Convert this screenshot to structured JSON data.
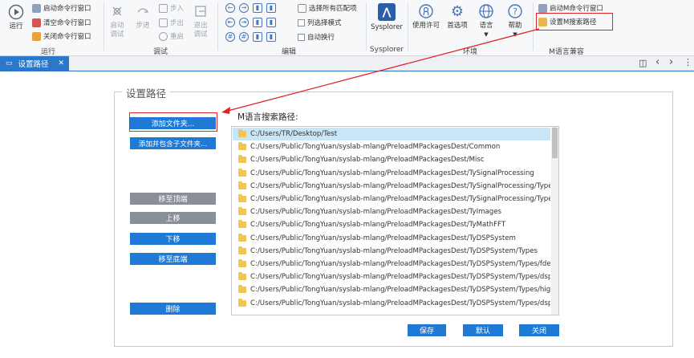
{
  "ribbon": {
    "run_group": {
      "run_label": "运行",
      "cmd_start": "启动命令行窗口",
      "cmd_clear": "清空命令行窗口",
      "cmd_close": "关闭命令行窗口",
      "group_label": "运行"
    },
    "debug_group": {
      "start_debug": "启动\n调试",
      "step_over": "步进",
      "step_in": "步入",
      "step_out": "步出",
      "restart": "重启",
      "exit_debug": "退出\n调试",
      "group_label": "调试"
    },
    "edit_group": {
      "select_all_matches": "选择所有匹配项",
      "column_select": "列选择模式",
      "auto_wrap": "自动换行",
      "group_label": "编辑"
    },
    "sysplorer_group": {
      "label": "Sysplorer",
      "group_label": "Sysplorer"
    },
    "env_group": {
      "license": "使用许可",
      "preferences": "首选项",
      "language": "语言",
      "help": "帮助",
      "group_label": "环境"
    },
    "mcompat_group": {
      "start_m_cmd": "启动M命令行窗口",
      "set_m_path": "设置M搜索路径",
      "group_label": "M语言兼容"
    }
  },
  "tabbar": {
    "tab_label": "设置路径",
    "close_glyph": "✕",
    "layout_glyph": "◫",
    "prev_glyph": "‹",
    "next_glyph": "›",
    "more_glyph": "⋮"
  },
  "dialog": {
    "legend": "设置路径",
    "path_list_label": "M语言搜索路径:",
    "buttons": {
      "add_folder": "添加文件夹...",
      "add_with_subfolders": "添加并包含子文件夹...",
      "move_top": "移至顶端",
      "move_up": "上移",
      "move_down": "下移",
      "move_bottom": "移至底端",
      "delete": "删除",
      "save": "保存",
      "default": "默认",
      "close": "关闭"
    },
    "paths": [
      "C:/Users/TR/Desktop/Test",
      "C:/Users/Public/TongYuan/syslab-mlang/PreloadMPackagesDest/Common",
      "C:/Users/Public/TongYuan/syslab-mlang/PreloadMPackagesDest/Misc",
      "C:/Users/Public/TongYuan/syslab-mlang/PreloadMPackagesDest/TySignalProcessing",
      "C:/Users/Public/TongYuan/syslab-mlang/PreloadMPackagesDest/TySignalProcessing/Types",
      "C:/Users/Public/TongYuan/syslab-mlang/PreloadMPackagesDest/TySignalProcessing/Types/EDFIn",
      "C:/Users/Public/TongYuan/syslab-mlang/PreloadMPackagesDest/TyImages",
      "C:/Users/Public/TongYuan/syslab-mlang/PreloadMPackagesDest/TyMathFFT",
      "C:/Users/Public/TongYuan/syslab-mlang/PreloadMPackagesDest/TyDSPSystem",
      "C:/Users/Public/TongYuan/syslab-mlang/PreloadMPackagesDest/TyDSPSystem/Types",
      "C:/Users/Public/TongYuan/syslab-mlang/PreloadMPackagesDest/TyDSPSystem/Types/fdesign.cicc",
      "C:/Users/Public/TongYuan/syslab-mlang/PreloadMPackagesDest/TyDSPSystem/Types/dsp.FIRFilte",
      "C:/Users/Public/TongYuan/syslab-mlang/PreloadMPackagesDest/TyDSPSystem/Types/highpass",
      "C:/Users/Public/TongYuan/syslab-mlang/PreloadMPackagesDest/TyDSPSystem/Types/dsp_Biquad"
    ],
    "selected_index": 0
  },
  "colors": {
    "accent": "#1f7ad6",
    "selection": "#c8e6f5",
    "annotation": "#e02424",
    "disabled_button": "#8a8f96"
  }
}
